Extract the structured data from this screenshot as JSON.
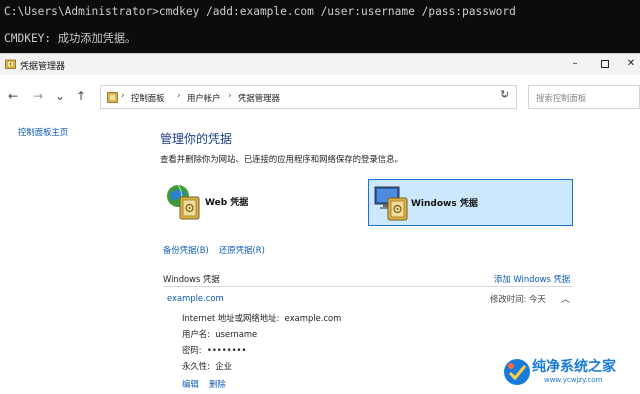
{
  "terminal": {
    "line1": "C:\\Users\\Administrator>cmdkey /add:example.com /user:username /pass:password",
    "line2": "CMDKEY: 成功添加凭据。"
  },
  "window": {
    "title": "凭据管理器",
    "controls": {
      "minimize": "–",
      "close": "✕"
    }
  },
  "nav": {
    "back": "←",
    "forward": "→",
    "recent": "⌄",
    "up": "↑",
    "breadcrumb": [
      "控制面板",
      "用户帐户",
      "凭据管理器"
    ],
    "separator": "›",
    "refresh": "↻",
    "search_placeholder": "搜索控制面板"
  },
  "sidebar": {
    "home_link": "控制面板主页"
  },
  "main": {
    "heading": "管理你的凭据",
    "description": "查看并删除你为网站、已连接的应用程序和网络保存的登录信息。",
    "tiles": [
      {
        "label": "Web 凭据",
        "icon": "globe-vault-icon",
        "selected": false
      },
      {
        "label": "Windows 凭据",
        "icon": "monitor-vault-icon",
        "selected": true
      }
    ],
    "backup_link": "备份凭据(B)",
    "restore_link": "还原凭据(R)",
    "section_title": "Windows 凭据",
    "add_link": "添加 Windows 凭据",
    "entry": {
      "name": "example.com",
      "modified_label": "修改时间:",
      "modified_value": "今天",
      "caret": "︿",
      "details": [
        "Internet 地址或网络地址:  example.com",
        "用户名:  username",
        "密码:  ••••••••",
        "永久性:  企业"
      ],
      "edit": "编辑",
      "delete": "删除"
    }
  },
  "watermark": {
    "title": "纯净系统之家",
    "url": "www.ycwjzy.com"
  },
  "colors": {
    "link": "#0b5cb8",
    "heading": "#1e3c8c",
    "selected_tile_bg": "#cce8ff",
    "selected_tile_border": "#1d6fd1"
  }
}
